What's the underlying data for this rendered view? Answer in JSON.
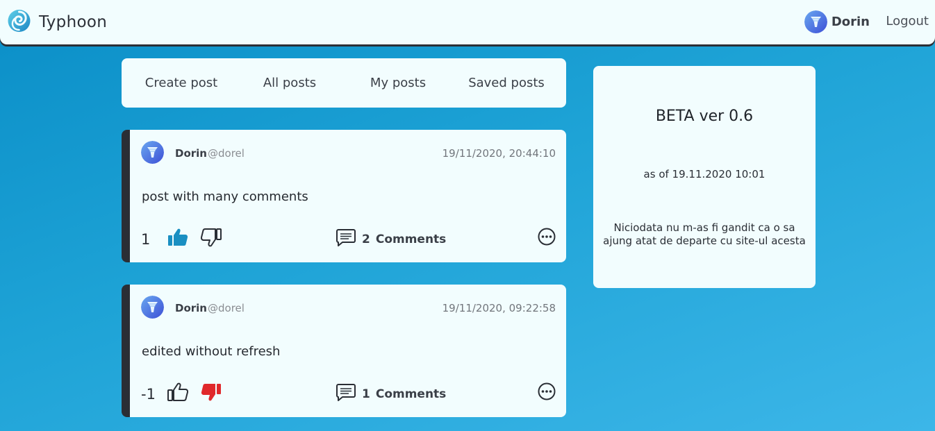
{
  "header": {
    "brand_name": "Typhoon",
    "user_name": "Dorin",
    "logout_label": "Logout"
  },
  "tabs": [
    {
      "label": "Create post"
    },
    {
      "label": "All posts"
    },
    {
      "label": "My posts"
    },
    {
      "label": "Saved posts"
    }
  ],
  "posts": [
    {
      "author": "Dorin",
      "handle": "@dorel",
      "timestamp": "19/11/2020, 20:44:10",
      "body": "post with many comments",
      "score": "1",
      "liked": true,
      "disliked": false,
      "comment_count": "2",
      "comment_label": "Comments"
    },
    {
      "author": "Dorin",
      "handle": "@dorel",
      "timestamp": "19/11/2020, 09:22:58",
      "body": "edited without refresh",
      "score": "-1",
      "liked": false,
      "disliked": true,
      "comment_count": "1",
      "comment_label": "Comments"
    }
  ],
  "beta_panel": {
    "title": "BETA ver 0.6",
    "as_of": "as of 19.11.2020 10:01",
    "message": "Niciodata nu m-as fi gandit ca o sa ajung atat de departe cu site-ul acesta"
  },
  "colors": {
    "accent_blue": "#1a8fc2",
    "dislike_red": "#e0282b",
    "card_bg": "#f2fdfe",
    "dark": "#2a2e35"
  },
  "icons": {
    "brand": "typhoon-swirl-icon",
    "like": "thumbs-up-icon",
    "dislike": "thumbs-down-icon",
    "comments": "comment-bubble-icon",
    "more": "more-options-icon"
  }
}
